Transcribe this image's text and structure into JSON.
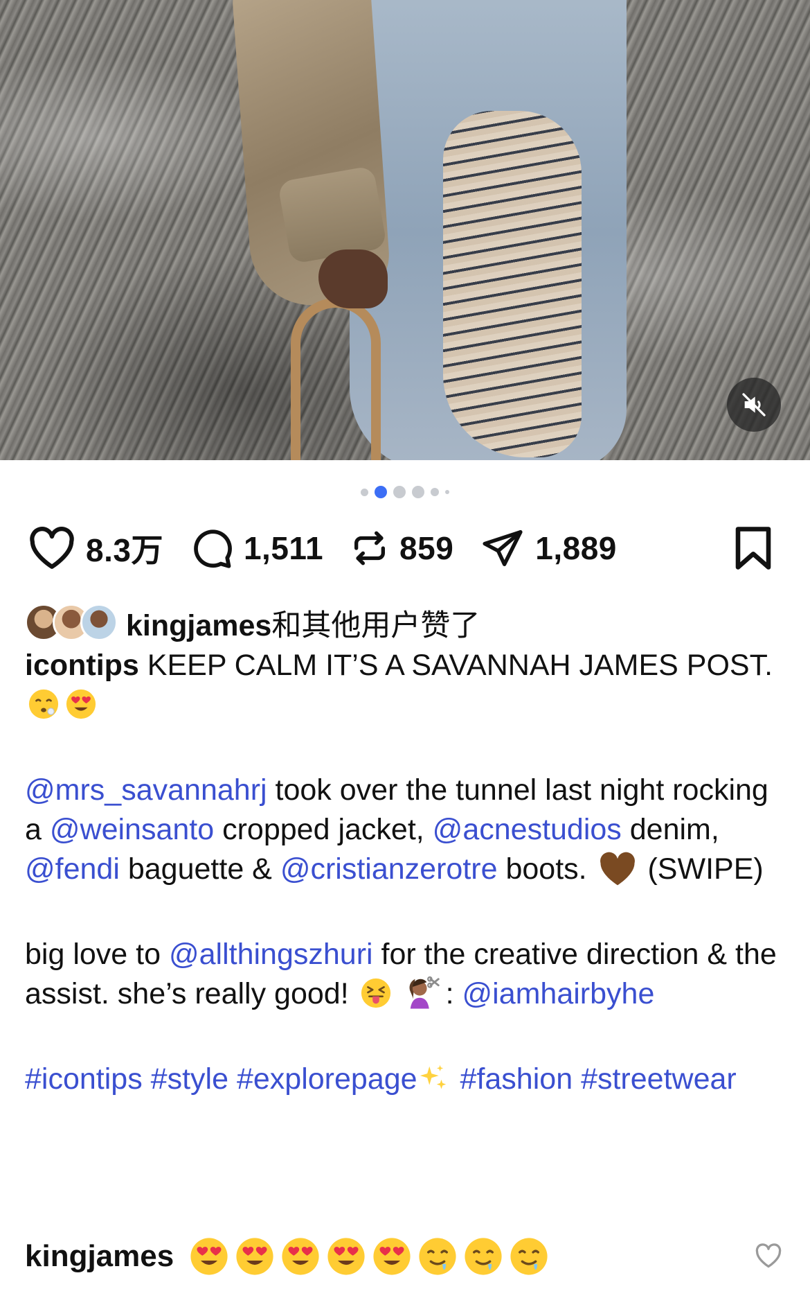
{
  "media": {
    "carousel_total": 6,
    "carousel_active": 2
  },
  "actions": {
    "likes": "8.3万",
    "comments": "1,511",
    "reposts": "859",
    "shares": "1,889"
  },
  "liked_by": {
    "username": "kingjames",
    "suffix": "和其他用户赞了"
  },
  "caption": {
    "username": "icontips",
    "line1_text": " KEEP CALM IT’S A SAVANNAH JAMES POST. ",
    "p2": {
      "m1": "@mrs_savannahrj",
      "t1": " took over the tunnel last night rocking a ",
      "m2": "@weinsanto",
      "t2": " cropped jacket, ",
      "m3": "@acnestudios",
      "t3": " denim, ",
      "m4": "@fendi",
      "t4": " baguette & ",
      "m5": "@cristianzerotre",
      "t5": " boots. ",
      "t6": " (SWIPE)"
    },
    "p3": {
      "t1": "big love to ",
      "m1": "@allthingszhuri",
      "t2": " for the creative direction & the assist. she’s really good! ",
      "t3": ": ",
      "m2": "@iamhairbyhe"
    },
    "hashtags": {
      "h1": "#icontips",
      "h2": "#style",
      "h3": "#explorepage",
      "h4": "#fashion",
      "h5": "#streetwear"
    }
  },
  "comment": {
    "username": "kingjames"
  },
  "colors": {
    "accent": "#3c6ef5",
    "mention": "#3a4fd0"
  }
}
